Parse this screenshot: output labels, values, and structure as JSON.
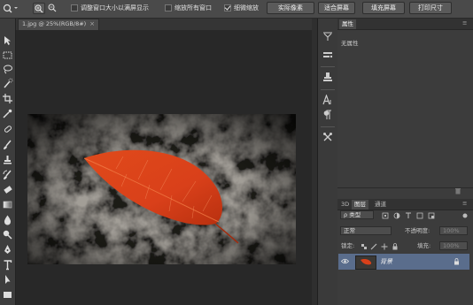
{
  "optionbar": {
    "resize_windows_label": "调整窗口大小以满屏显示",
    "resize_windows_checked": false,
    "zoom_all_label": "缩放所有窗口",
    "zoom_all_checked": false,
    "scrubby_zoom_label": "细微缩放",
    "scrubby_zoom_checked": true,
    "actual_pixels_label": "实际像素",
    "fit_screen_label": "适合屏幕",
    "fill_screen_label": "填充屏幕",
    "print_size_label": "打印尺寸"
  },
  "document": {
    "tab_label": "1.jpg @ 25%(RGB/8#)",
    "close_glyph": "×"
  },
  "properties_panel": {
    "tab_label": "属性",
    "content_label": "无属性"
  },
  "layers_panel": {
    "tabs": [
      "3D",
      "图层",
      "通道"
    ],
    "active_tab_index": 1,
    "filter_label": "ρ 类型",
    "blend_mode": "正常",
    "opacity_label": "不透明度:",
    "opacity_value": "100%",
    "lock_label": "锁定:",
    "fill_label": "填充:",
    "fill_value": "100%",
    "layers": [
      {
        "name": "背景",
        "visible": true,
        "locked": true,
        "selected": true
      }
    ]
  },
  "colors": {
    "leaf": "#d9401a",
    "selected_layer": "#5a6d8c",
    "ui_background": "#2b2b2b"
  }
}
